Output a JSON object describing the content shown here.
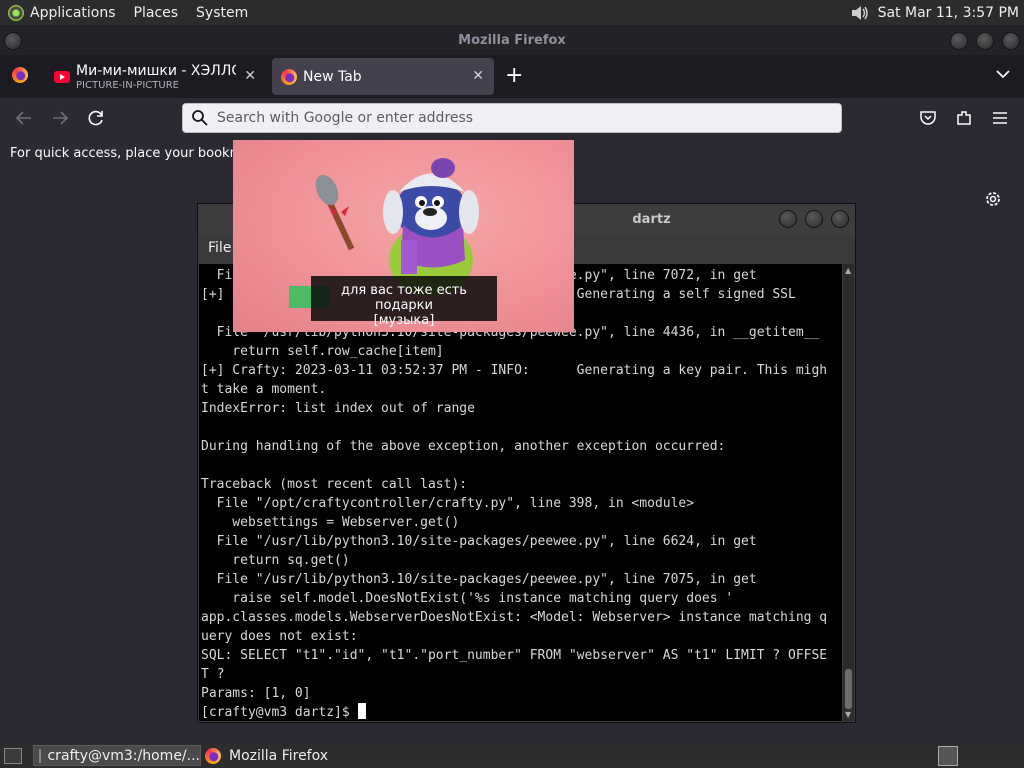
{
  "top_panel": {
    "menus": [
      "Applications",
      "Places",
      "System"
    ],
    "clock": "Sat Mar 11,  3:57 PM"
  },
  "firefox": {
    "window_title": "Mozilla Firefox",
    "tabs": [
      {
        "label": "Ми-ми-мишки - ХЭЛЛОУИН",
        "sublabel": "PICTURE-IN-PICTURE",
        "close": "✕"
      },
      {
        "label": "New Tab",
        "close": "✕"
      }
    ],
    "new_tab": "+",
    "url_placeholder": "Search with Google or enter address",
    "bookmarks_hint": "For quick access, place your bookmarks here on the bookmarks toolbar."
  },
  "pip": {
    "caption_line1": "для вас тоже есть подарки",
    "caption_line2": "[музыка]"
  },
  "terminal": {
    "title": "dartz",
    "menu_file": "File",
    "lines": [
      "  File \"/usr/lib/python3.10/site-packages/peewee.py\", line 7072, in get",
      "[+] Crafty: 2023-03-11 03:52:37 PM - INFO:      Generating a self signed SSL",
      "",
      "  File \"/usr/lib/python3.10/site-packages/peewee.py\", line 4436, in __getitem__",
      "    return self.row_cache[item]",
      "[+] Crafty: 2023-03-11 03:52:37 PM - INFO:      Generating a key pair. This migh",
      "t take a moment.",
      "IndexError: list index out of range",
      "",
      "During handling of the above exception, another exception occurred:",
      "",
      "Traceback (most recent call last):",
      "  File \"/opt/craftycontroller/crafty.py\", line 398, in <module>",
      "    websettings = Webserver.get()",
      "  File \"/usr/lib/python3.10/site-packages/peewee.py\", line 6624, in get",
      "    return sq.get()",
      "  File \"/usr/lib/python3.10/site-packages/peewee.py\", line 7075, in get",
      "    raise self.model.DoesNotExist('%s instance matching query does '",
      "app.classes.models.WebserverDoesNotExist: <Model: Webserver> instance matching q",
      "uery does not exist:",
      "SQL: SELECT \"t1\".\"id\", \"t1\".\"port_number\" FROM \"webserver\" AS \"t1\" LIMIT ? OFFSE",
      "T ?",
      "Params: [1, 0]"
    ],
    "prompt": "[crafty@vm3 dartz]$ "
  },
  "taskbar": {
    "terminal_task": "crafty@vm3:/home/...",
    "firefox_task": "Mozilla Firefox"
  }
}
